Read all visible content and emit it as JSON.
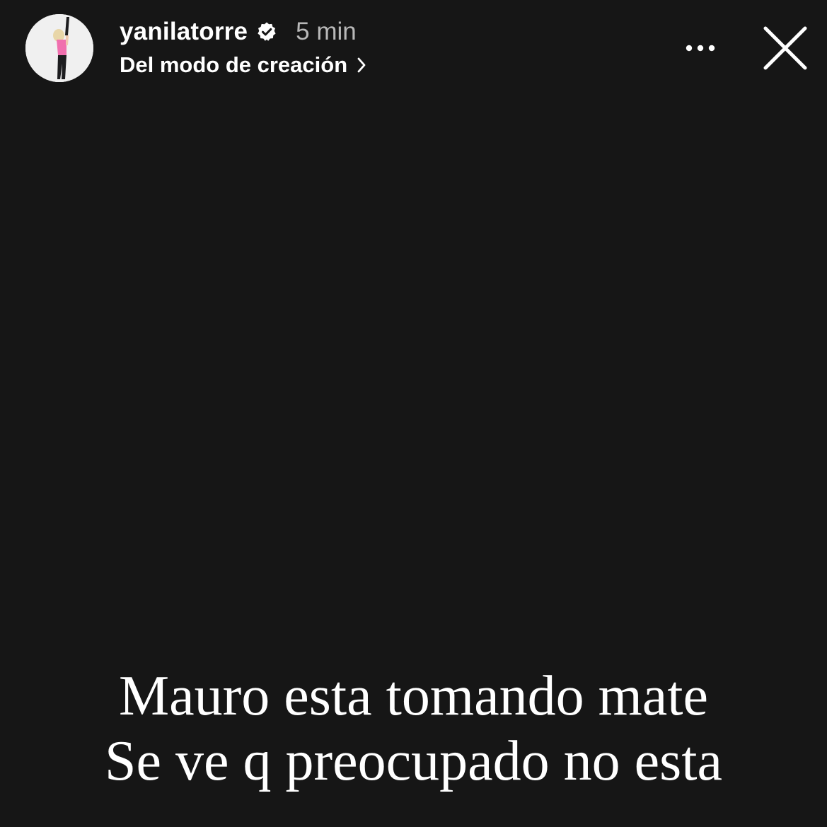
{
  "header": {
    "username": "yanilatorre",
    "time": "5 min",
    "subtitle": "Del modo de creación",
    "icons": {
      "verified": "verified-badge-icon",
      "chevron": "chevron-right-icon",
      "more": "more-dots-icon",
      "close": "close-icon"
    }
  },
  "caption": {
    "line1": "Mauro esta tomando mate",
    "line2": "Se ve q preocupado no esta"
  },
  "colors": {
    "background": "#161616",
    "text": "#ffffff",
    "muted": "#b8b8b8",
    "avatar_outfit": "#f06fae"
  }
}
